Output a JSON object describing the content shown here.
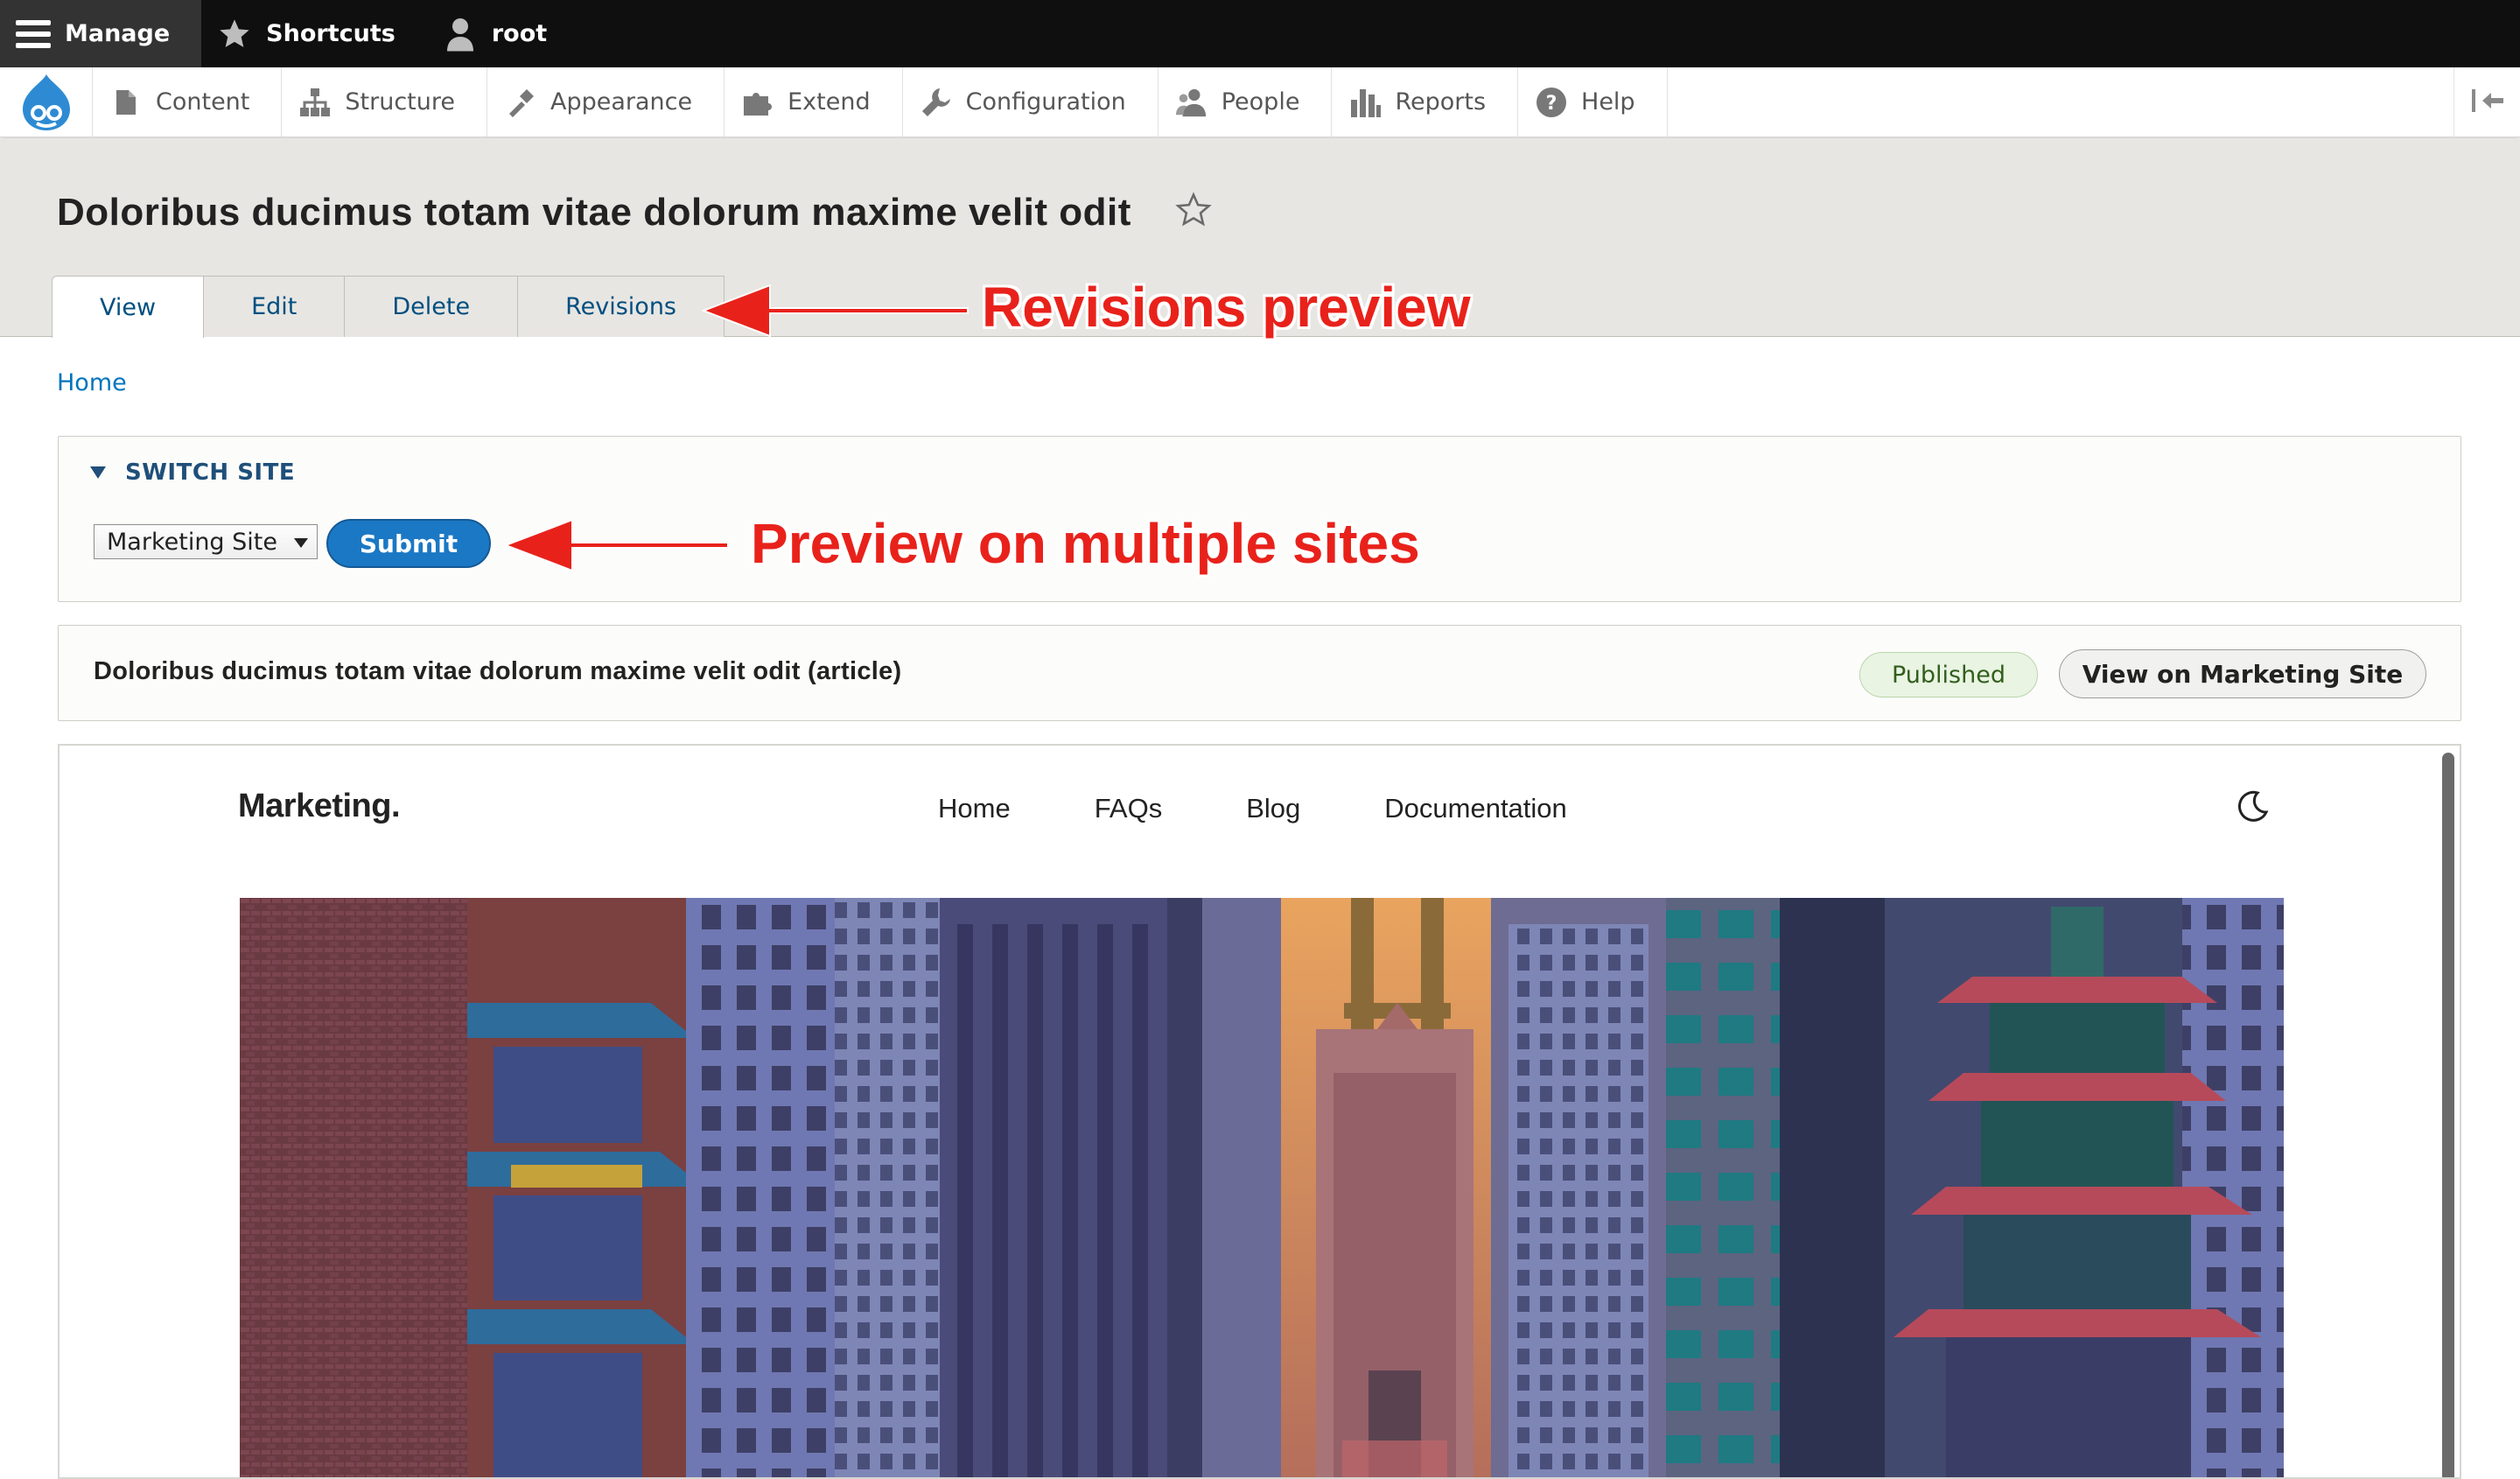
{
  "toolbar": {
    "manage_label": "Manage",
    "shortcuts_label": "Shortcuts",
    "user_label": "root"
  },
  "tray": {
    "items": [
      {
        "label": "Content",
        "icon": "file-icon"
      },
      {
        "label": "Structure",
        "icon": "sitemap-icon"
      },
      {
        "label": "Appearance",
        "icon": "brush-icon"
      },
      {
        "label": "Extend",
        "icon": "puzzle-icon"
      },
      {
        "label": "Configuration",
        "icon": "wrench-icon"
      },
      {
        "label": "People",
        "icon": "people-icon"
      },
      {
        "label": "Reports",
        "icon": "bar-chart-icon"
      },
      {
        "label": "Help",
        "icon": "help-icon"
      }
    ]
  },
  "page": {
    "title": "Doloribus ducimus totam vitae dolorum maxime velit odit",
    "tabs": [
      {
        "label": "View",
        "active": true
      },
      {
        "label": "Edit",
        "active": false
      },
      {
        "label": "Delete",
        "active": false
      },
      {
        "label": "Revisions",
        "active": false
      }
    ]
  },
  "annotations": {
    "revisions": "Revisions preview",
    "multisite": "Preview on multiple sites",
    "color": "#e8221b"
  },
  "breadcrumb": {
    "home": "Home"
  },
  "switch_site": {
    "legend": "SWITCH SITE",
    "selected_site": "Marketing Site",
    "submit_label": "Submit"
  },
  "node_info": {
    "title": "Doloribus ducimus totam vitae dolorum maxime velit odit (article)",
    "status": "Published",
    "view_button": "View on Marketing Site"
  },
  "preview": {
    "brand": "Marketing.",
    "nav": [
      "Home",
      "FAQs",
      "Blog",
      "Documentation"
    ],
    "theme_toggle_icon": "moon-icon",
    "hero_image": "city-street-photo"
  },
  "colors": {
    "link": "#0074bd",
    "primary_button": "#1b78c4",
    "published_bg": "#e9f4e3",
    "toolbar_bg": "#0f0f0f"
  }
}
